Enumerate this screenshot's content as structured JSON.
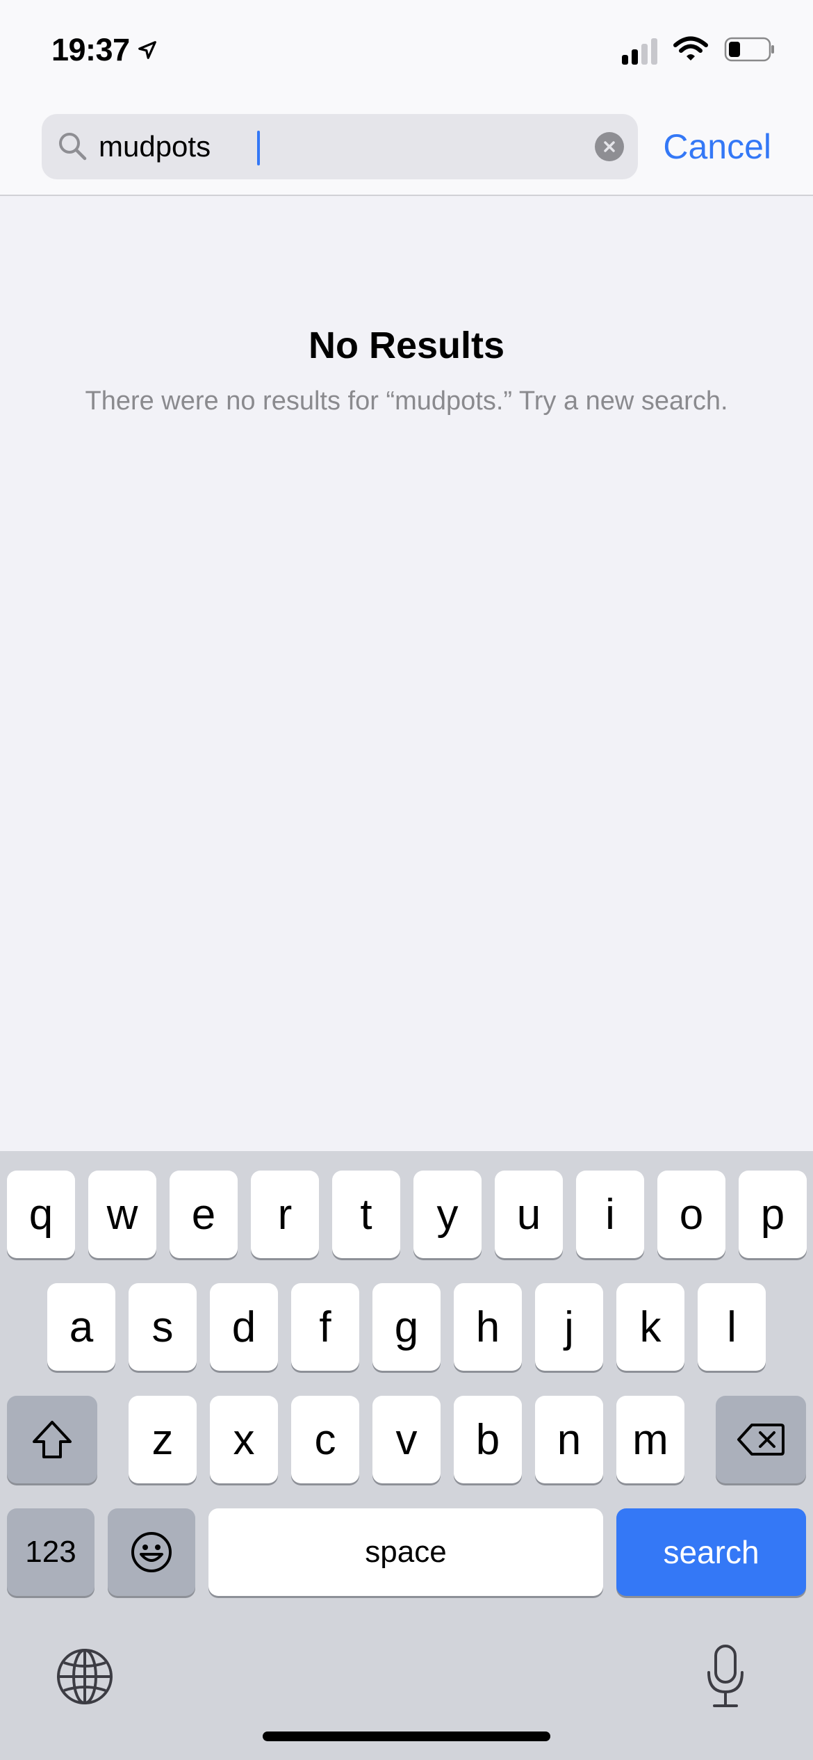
{
  "status_bar": {
    "time": "19:37"
  },
  "search": {
    "query": "mudpots",
    "cancel_label": "Cancel"
  },
  "empty_state": {
    "title": "No Results",
    "message": "There were no results for “mudpots.” Try a new search."
  },
  "keyboard": {
    "row1": [
      "q",
      "w",
      "e",
      "r",
      "t",
      "y",
      "u",
      "i",
      "o",
      "p"
    ],
    "row2": [
      "a",
      "s",
      "d",
      "f",
      "g",
      "h",
      "j",
      "k",
      "l"
    ],
    "row3": [
      "z",
      "x",
      "c",
      "v",
      "b",
      "n",
      "m"
    ],
    "numbers_label": "123",
    "space_label": "space",
    "search_label": "search"
  },
  "colors": {
    "accent": "#3478f6",
    "keyboard_bg": "#d2d4da",
    "page_bg": "#f2f2f7"
  }
}
